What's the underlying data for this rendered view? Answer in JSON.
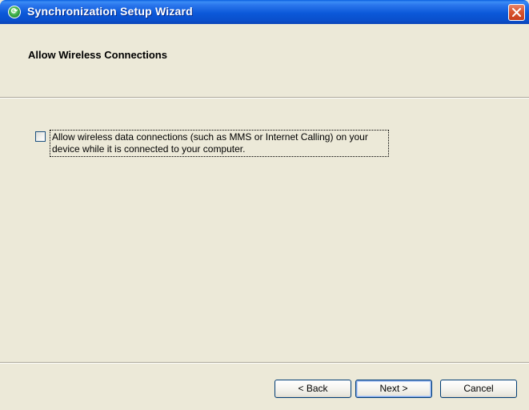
{
  "window": {
    "title": "Synchronization Setup Wizard",
    "icon": "sync-icon",
    "close_icon": "close-icon"
  },
  "header": {
    "title": "Allow Wireless Connections"
  },
  "option": {
    "checked": false,
    "label": "Allow wireless data connections (such as MMS or Internet Calling) on your device while it is connected to your computer."
  },
  "buttons": {
    "back": "< Back",
    "next": "Next >",
    "cancel": "Cancel"
  },
  "colors": {
    "titlebar": "#0a58d9",
    "face": "#ece9d8",
    "close": "#d9552f"
  }
}
